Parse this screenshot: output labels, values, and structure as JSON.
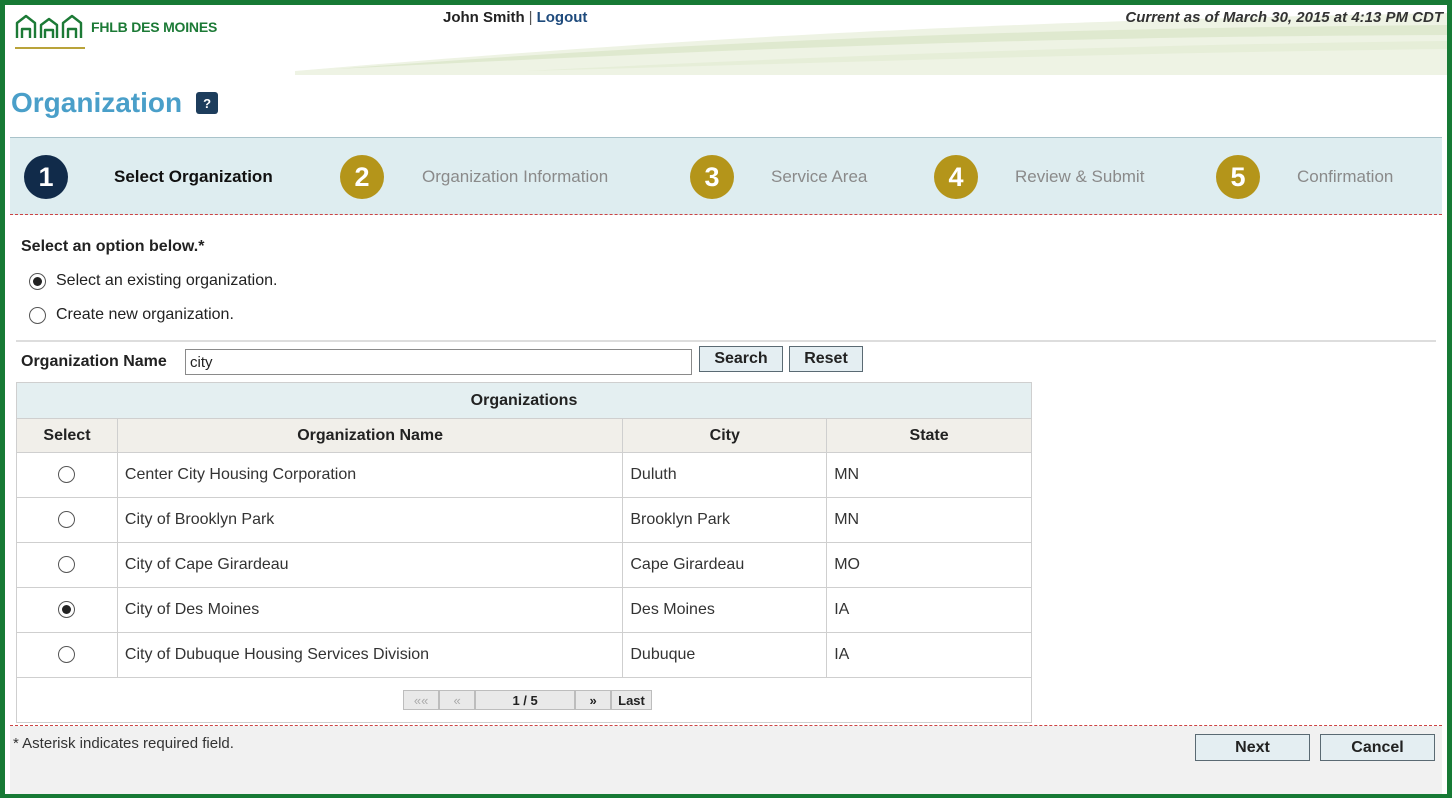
{
  "header": {
    "logo_text": "FHLB DES MOINES",
    "user_name": "John Smith",
    "separator": "|",
    "logout_label": "Logout",
    "as_of": "Current as of March 30, 2015 at 4:13 PM CDT"
  },
  "page": {
    "title": "Organization",
    "help_label": "?"
  },
  "steps": [
    {
      "number": "1",
      "label": "Select Organization",
      "state": "active"
    },
    {
      "number": "2",
      "label": "Organization Information",
      "state": "pending"
    },
    {
      "number": "3",
      "label": "Service Area",
      "state": "pending"
    },
    {
      "number": "4",
      "label": "Review & Submit",
      "state": "pending"
    },
    {
      "number": "5",
      "label": "Confirmation",
      "state": "pending"
    }
  ],
  "options": {
    "prompt": "Select an option below.*",
    "items": [
      {
        "label": "Select an existing organization.",
        "selected": true
      },
      {
        "label": "Create new organization.",
        "selected": false
      }
    ]
  },
  "search": {
    "label": "Organization Name",
    "value": "city",
    "search_label": "Search",
    "reset_label": "Reset"
  },
  "table": {
    "caption": "Organizations",
    "columns": [
      "Select",
      "Organization Name",
      "City",
      "State"
    ],
    "rows": [
      {
        "name": "Center City Housing Corporation",
        "city": "Duluth",
        "state": "MN",
        "selected": false
      },
      {
        "name": "City of Brooklyn Park",
        "city": "Brooklyn Park",
        "state": "MN",
        "selected": false
      },
      {
        "name": "City of Cape Girardeau",
        "city": "Cape Girardeau",
        "state": "MO",
        "selected": false
      },
      {
        "name": "City of Des Moines",
        "city": "Des Moines",
        "state": "IA",
        "selected": true
      },
      {
        "name": "City of Dubuque Housing Services Division",
        "city": "Dubuque",
        "state": "IA",
        "selected": false
      }
    ],
    "pager": {
      "first": "««",
      "prev": "«",
      "page": "1 / 5",
      "next": "»",
      "last": "Last"
    }
  },
  "footer": {
    "note": "* Asterisk indicates required field.",
    "next_label": "Next",
    "cancel_label": "Cancel"
  },
  "colors": {
    "frame": "#177a35",
    "title": "#4a9fc9",
    "step_active": "#112b4a",
    "step_pending": "#b4951a"
  }
}
